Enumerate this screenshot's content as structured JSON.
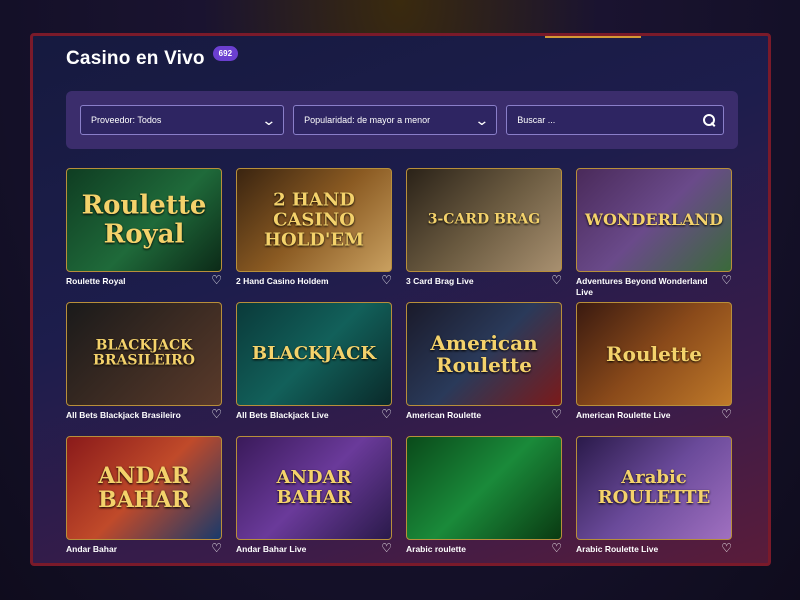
{
  "page": {
    "title": "Casino en Vivo",
    "count": "692"
  },
  "filters": {
    "provider": "Proveedor: Todos",
    "sort": "Popularidad: de mayor a menor",
    "search_placeholder": "Buscar ...",
    "chevron_icon": "chevron-down-icon",
    "search_icon": "search-icon"
  },
  "colors": {
    "accent": "#6b3fd0",
    "border": "#b88f3a",
    "frame": "#7a1a2a"
  },
  "games": [
    {
      "name": "Roulette Royal",
      "art": "Roulette Royal",
      "bg": "linear-gradient(135deg,#0f3d22,#1f6a3a 55%,#0c2a18)"
    },
    {
      "name": "2 Hand Casino Holdem",
      "art": "2 HAND CASINO HOLD'EM",
      "bg": "linear-gradient(135deg,#3a2410,#8a5a22 50%,#c9a060)"
    },
    {
      "name": "3 Card Brag Live",
      "art": "3-CARD BRAG",
      "bg": "linear-gradient(135deg,#2a2218,#6a5a40 50%,#a89070)"
    },
    {
      "name": "Adventures Beyond Wonderland Live",
      "art": "WONDERLAND",
      "bg": "linear-gradient(135deg,#4a2a5a,#6a4a8a 50%,#3a6a3a)"
    },
    {
      "name": "All Bets Blackjack Brasileiro",
      "art": "BLACKJACK BRASILEIRO",
      "bg": "linear-gradient(135deg,#1a1a1a,#3a2a22 50%,#5a3a2a)"
    },
    {
      "name": "All Bets Blackjack Live",
      "art": "BLACKJACK",
      "bg": "linear-gradient(135deg,#0a3a3a,#12605a 50%,#0a2a2a)"
    },
    {
      "name": "American Roulette",
      "art": "American Roulette",
      "bg": "linear-gradient(135deg,#1a1a2a,#2a3a5a 50%,#7a1a1a)"
    },
    {
      "name": "American Roulette Live",
      "art": "Roulette",
      "bg": "linear-gradient(135deg,#3a1a10,#8a4a1a 50%,#c07a2a)"
    },
    {
      "name": "Andar Bahar",
      "art": "ANDAR BAHAR",
      "bg": "linear-gradient(135deg,#8a1a1a,#c04a2a 50%,#1a3a6a)"
    },
    {
      "name": "Andar Bahar Live",
      "art": "ANDAR BAHAR",
      "bg": "linear-gradient(135deg,#3a1a5a,#6a3a9a 50%,#2a1a4a)"
    },
    {
      "name": "Arabic roulette",
      "art": "",
      "bg": "linear-gradient(135deg,#0a4a1a,#1a8a3a 50%,#0a3a12)"
    },
    {
      "name": "Arabic Roulette Live",
      "art": "Arabic ROULETTE",
      "bg": "linear-gradient(135deg,#2a1a4a,#6a4a9a 50%,#a070c0)"
    }
  ]
}
